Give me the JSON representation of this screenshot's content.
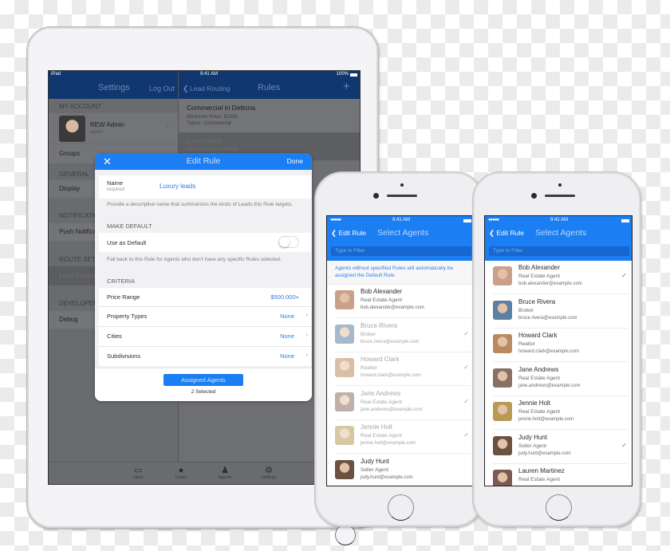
{
  "ipad": {
    "status": {
      "device": "iPad",
      "time": "9:41 AM",
      "battery": "100%"
    },
    "left_nav": {
      "title": "Settings",
      "action": "Log Out"
    },
    "right_nav": {
      "back": "Lead Routing",
      "title": "Rules",
      "add_icon": "plus-icon"
    },
    "sidebar": {
      "my_account_header": "MY ACCOUNT",
      "user_name": "REW Admin",
      "user_role": "admin",
      "groups": "Groups",
      "general_header": "GENERAL",
      "display": "Display",
      "notifications_header": "NOTIFICATIONS",
      "push": "Push Notifications",
      "route_header": "ROUTE SETTINGS",
      "lead_routing": "Lead Routing",
      "developer_header": "DEVELOPER",
      "debug": "Debug"
    },
    "rules": [
      {
        "title": "Commercial in Deltona",
        "line1": "Minimum Price: $200k",
        "line2": "Types: Commercial"
      },
      {
        "title": "Luxury leads",
        "line1": "Minimum Price: $500k"
      }
    ],
    "tabs": [
      {
        "label": "Inbox",
        "icon": "inbox-icon"
      },
      {
        "label": "Leads",
        "icon": "flame-icon"
      },
      {
        "label": "Agents",
        "icon": "person-icon"
      },
      {
        "label": "Settings",
        "icon": "gear-icon"
      }
    ],
    "modal": {
      "close_icon": "close-icon",
      "title": "Edit Rule",
      "done": "Done",
      "name_label": "Name",
      "name_required": "required",
      "name_value": "Luxury leads",
      "name_note": "Provide a descriptive name that summarizes the kinds of Leads this Rule targets.",
      "make_default_header": "MAKE DEFAULT",
      "use_default_label": "Use as Default",
      "use_default_on": false,
      "default_note": "Fall back to this Rule for Agents who don't have any specific Rules selected.",
      "criteria_header": "CRITERIA",
      "criteria": [
        {
          "label": "Price Range",
          "value": "$500,000+",
          "chevron": false
        },
        {
          "label": "Property Types",
          "value": "None",
          "chevron": true
        },
        {
          "label": "Cities",
          "value": "None",
          "chevron": true
        },
        {
          "label": "Subdivisions",
          "value": "None",
          "chevron": true
        }
      ],
      "assigned_button": "Assigned Agents",
      "assigned_count": "2 Selected"
    }
  },
  "phones": [
    {
      "status": {
        "time": "9:41 AM"
      },
      "back": "Edit Rule",
      "title": "Select Agents",
      "filter_placeholder": "Type to Filter",
      "info": "Agents without specified Rules will automatically be assigned the Default Rule.",
      "agents": [
        {
          "name": "Bob Alexander",
          "role": "Real Estate Agent",
          "email": "bob.alexander@example.com",
          "checked": false,
          "dim": false
        },
        {
          "name": "Bruce Rivera",
          "role": "Broker",
          "email": "bruce.rivera@example.com",
          "checked": true,
          "dim": true
        },
        {
          "name": "Howard Clark",
          "role": "Realtor",
          "email": "howard.clark@example.com",
          "checked": true,
          "dim": true
        },
        {
          "name": "Jane Andrews",
          "role": "Real Estate Agent",
          "email": "jane.andrews@example.com",
          "checked": true,
          "dim": true
        },
        {
          "name": "Jennie Holt",
          "role": "Real Estate Agent",
          "email": "jennie.holt@example.com",
          "checked": true,
          "dim": true
        },
        {
          "name": "Judy Hunt",
          "role": "Seller Agent",
          "email": "judy.hunt@example.com",
          "checked": false,
          "dim": false
        }
      ]
    },
    {
      "status": {
        "time": "9:41 AM"
      },
      "back": "Edit Rule",
      "title": "Select Agents",
      "filter_placeholder": "Type to Filter",
      "agents": [
        {
          "name": "Bob Alexander",
          "role": "Real Estate Agent",
          "email": "bob.alexander@example.com",
          "checked": true,
          "dim": false
        },
        {
          "name": "Bruce Rivera",
          "role": "Broker",
          "email": "bruce.rivera@example.com",
          "checked": false,
          "dim": false
        },
        {
          "name": "Howard Clark",
          "role": "Realtor",
          "email": "howard.clark@example.com",
          "checked": false,
          "dim": false
        },
        {
          "name": "Jane Andrews",
          "role": "Real Estate Agent",
          "email": "jane.andrews@example.com",
          "checked": false,
          "dim": false
        },
        {
          "name": "Jennie Holt",
          "role": "Real Estate Agent",
          "email": "jennie.holt@example.com",
          "checked": false,
          "dim": false
        },
        {
          "name": "Judy Hunt",
          "role": "Seller Agent",
          "email": "judy.hunt@example.com",
          "checked": true,
          "dim": false
        },
        {
          "name": "Lauren Martinez",
          "role": "Real Estate Agent",
          "email": "",
          "checked": false,
          "dim": false
        }
      ]
    }
  ],
  "colors": {
    "accent": "#1b7ef3",
    "ipad_nav": "#10376f",
    "link": "#2f7de5"
  }
}
